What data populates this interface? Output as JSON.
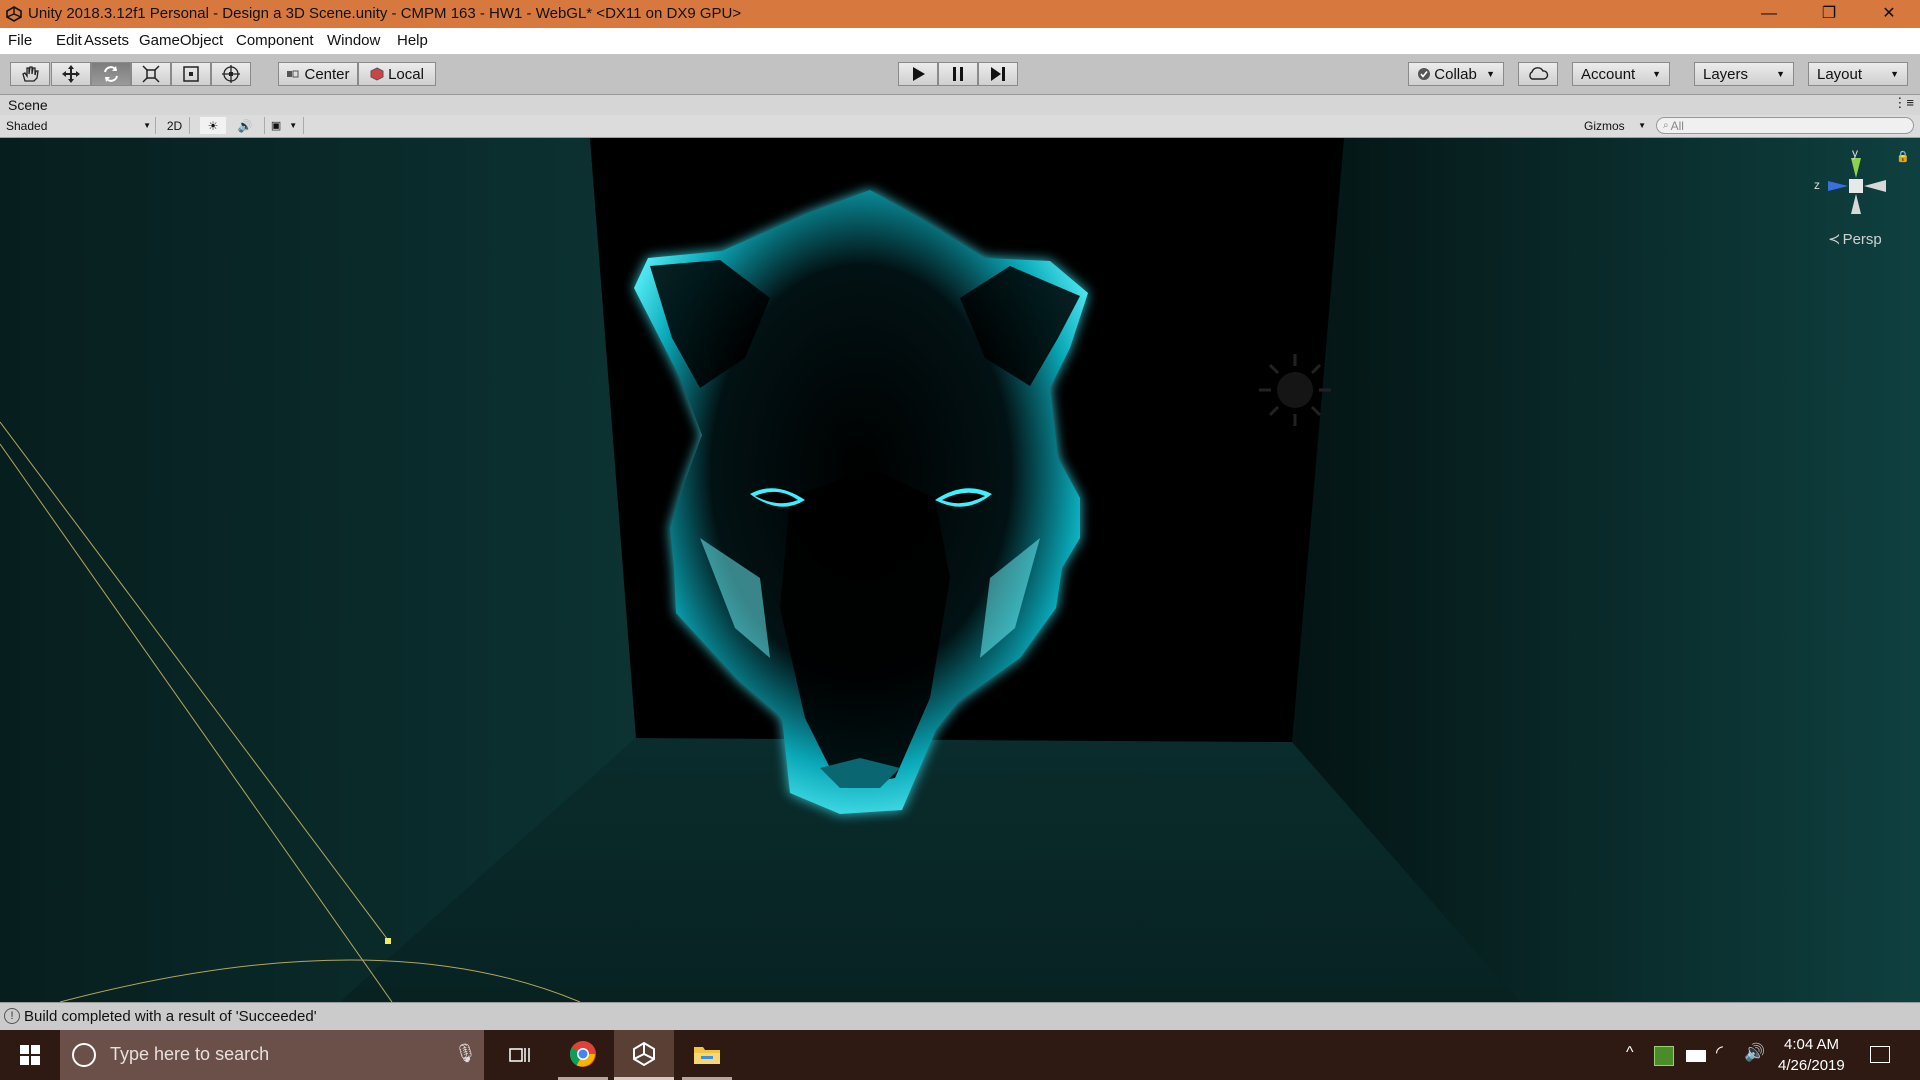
{
  "window": {
    "title": "Unity 2018.3.12f1 Personal - Design a 3D Scene.unity - CMPM 163 - HW1 - WebGL* <DX11 on DX9 GPU>",
    "minimize": "—",
    "restore": "❐",
    "close": "✕"
  },
  "menu": [
    "File",
    "Edit",
    "Assets",
    "GameObject",
    "Component",
    "Window",
    "Help"
  ],
  "toolbar": {
    "center_label": "Center",
    "local_label": "Local",
    "collab_label": "Collab",
    "account_label": "Account",
    "layers_label": "Layers",
    "layout_label": "Layout"
  },
  "scene": {
    "tab_label": "Scene",
    "shading_mode": "Shaded",
    "toggle_2d": "2D",
    "gizmos_label": "Gizmos",
    "search_placeholder": "All",
    "persp_label": "Persp",
    "axis_y": "y",
    "axis_z": "z"
  },
  "status": {
    "message": "Build completed with a result of 'Succeeded'"
  },
  "taskbar": {
    "search_placeholder": "Type here to search",
    "time": "4:04 AM",
    "date": "4/26/2019"
  },
  "colors": {
    "title_bar": "#d7793f",
    "glow_cyan": "#3ff0ff",
    "room_teal": "#0d3a3a",
    "taskbar": "#2e1a12"
  }
}
